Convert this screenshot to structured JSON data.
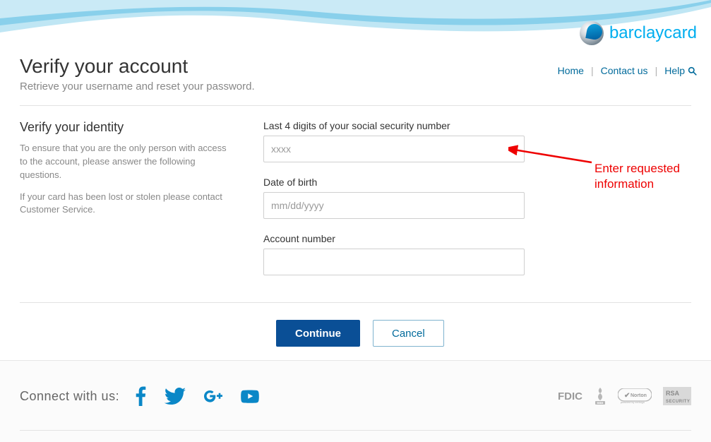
{
  "brand": {
    "name": "barclaycard"
  },
  "nav": {
    "home": "Home",
    "contact": "Contact us",
    "help": "Help"
  },
  "page_title": "Verify your account",
  "page_subhead": "Retrieve your username and reset your password.",
  "left": {
    "heading": "Verify your identity",
    "p1": "To ensure that you are the only person with access to the account, please answer the following questions.",
    "p2": "If your card has been lost or stolen please contact Customer Service."
  },
  "form": {
    "ssn4": {
      "label": "Last 4 digits of your social security number",
      "placeholder": "xxxx",
      "value": ""
    },
    "dob": {
      "label": "Date of birth",
      "placeholder": "mm/dd/yyyy",
      "value": ""
    },
    "acct": {
      "label": "Account number",
      "placeholder": "",
      "value": ""
    }
  },
  "buttons": {
    "continue": "Continue",
    "cancel": "Cancel"
  },
  "footer": {
    "connect_label": "Connect with us:",
    "badges": {
      "fdic": "FDIC",
      "bbb": "BBB",
      "norton": "Norton",
      "rsa_top": "RSA",
      "rsa_bottom": "SECURITY"
    }
  },
  "annotation": {
    "text1": "Enter requested",
    "text2": "information"
  },
  "colors": {
    "link": "#006a9b",
    "primary_btn": "#0a4f96",
    "brand_blue": "#00aeef",
    "annot_red": "#e00"
  }
}
